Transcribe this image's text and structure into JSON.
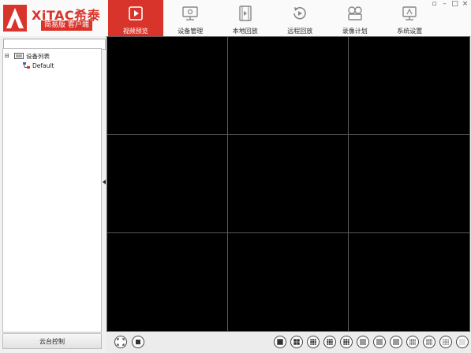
{
  "app": {
    "brand_name": "XiTAC希泰",
    "brand_sub": "简易版 客户端",
    "accent": "#d9342b"
  },
  "window_controls": [
    "▫",
    "–",
    "□",
    "×"
  ],
  "nav": {
    "items": [
      {
        "label": "视频预览",
        "icon": "video-preview-icon",
        "active": true
      },
      {
        "label": "设备管理",
        "icon": "device-management-icon",
        "active": false
      },
      {
        "label": "本地回放",
        "icon": "local-playback-icon",
        "active": false
      },
      {
        "label": "远程回放",
        "icon": "remote-playback-icon",
        "active": false
      },
      {
        "label": "录像计划",
        "icon": "record-plan-icon",
        "active": false
      },
      {
        "label": "系统设置",
        "icon": "system-settings-icon",
        "active": false
      }
    ]
  },
  "sidebar": {
    "search_value": "",
    "tree": {
      "root_label": "设备列表",
      "root_expander": "⊟",
      "child_label": "Default"
    },
    "ptz_label": "云台控制"
  },
  "video": {
    "grid_rows": 3,
    "grid_cols": 3
  },
  "bottombar": {
    "left_buttons": [
      "fullscreen-icon",
      "stop-icon"
    ],
    "layout_buttons": [
      1,
      4,
      6,
      8,
      9,
      10,
      13,
      16,
      20,
      25,
      36,
      64
    ]
  }
}
